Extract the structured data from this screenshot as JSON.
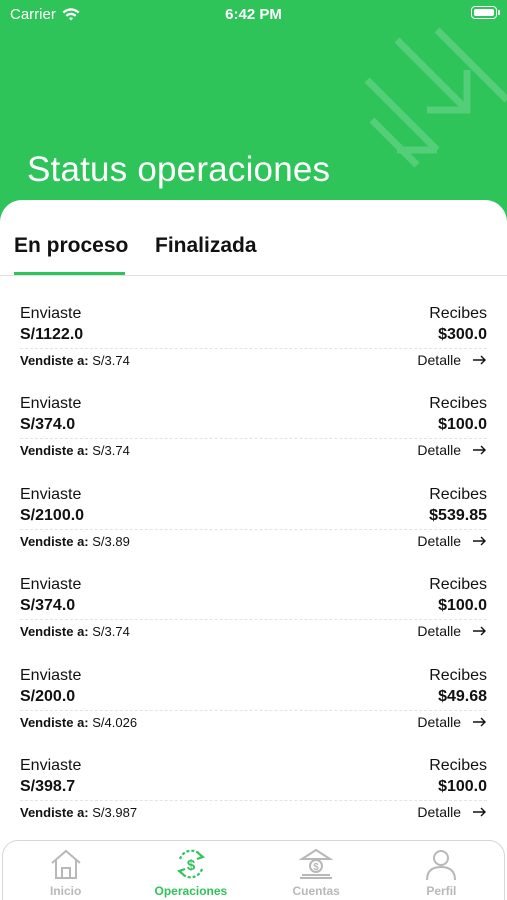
{
  "status_bar": {
    "carrier": "Carrier",
    "time": "6:42 PM"
  },
  "header": {
    "title": "Status operaciones"
  },
  "tabs": [
    {
      "label": "En proceso",
      "active": true
    },
    {
      "label": "Finalizada",
      "active": false
    }
  ],
  "operations": [
    {
      "sent_label": "Enviaste",
      "sent": "S/1122.0",
      "receive_label": "Recibes",
      "receive": "$300.0",
      "rate_label": "Vendiste a:",
      "rate": "S/3.74",
      "detail_label": "Detalle"
    },
    {
      "sent_label": "Enviaste",
      "sent": "S/374.0",
      "receive_label": "Recibes",
      "receive": "$100.0",
      "rate_label": "Vendiste a:",
      "rate": "S/3.74",
      "detail_label": "Detalle"
    },
    {
      "sent_label": "Enviaste",
      "sent": "S/2100.0",
      "receive_label": "Recibes",
      "receive": "$539.85",
      "rate_label": "Vendiste a:",
      "rate": "S/3.89",
      "detail_label": "Detalle"
    },
    {
      "sent_label": "Enviaste",
      "sent": "S/374.0",
      "receive_label": "Recibes",
      "receive": "$100.0",
      "rate_label": "Vendiste a:",
      "rate": "S/3.74",
      "detail_label": "Detalle"
    },
    {
      "sent_label": "Enviaste",
      "sent": "S/200.0",
      "receive_label": "Recibes",
      "receive": "$49.68",
      "rate_label": "Vendiste a:",
      "rate": "S/4.026",
      "detail_label": "Detalle"
    },
    {
      "sent_label": "Enviaste",
      "sent": "S/398.7",
      "receive_label": "Recibes",
      "receive": "$100.0",
      "rate_label": "Vendiste a:",
      "rate": "S/3.987",
      "detail_label": "Detalle"
    }
  ],
  "tab_bar": [
    {
      "label": "Inicio",
      "icon": "home-icon",
      "active": false
    },
    {
      "label": "Operaciones",
      "icon": "exchange-icon",
      "active": true
    },
    {
      "label": "Cuentas",
      "icon": "bank-icon",
      "active": false
    },
    {
      "label": "Perfil",
      "icon": "user-icon",
      "active": false
    }
  ],
  "colors": {
    "brand_green": "#2ec45a",
    "inactive_gray": "#b8b8b8",
    "text": "#111111"
  }
}
